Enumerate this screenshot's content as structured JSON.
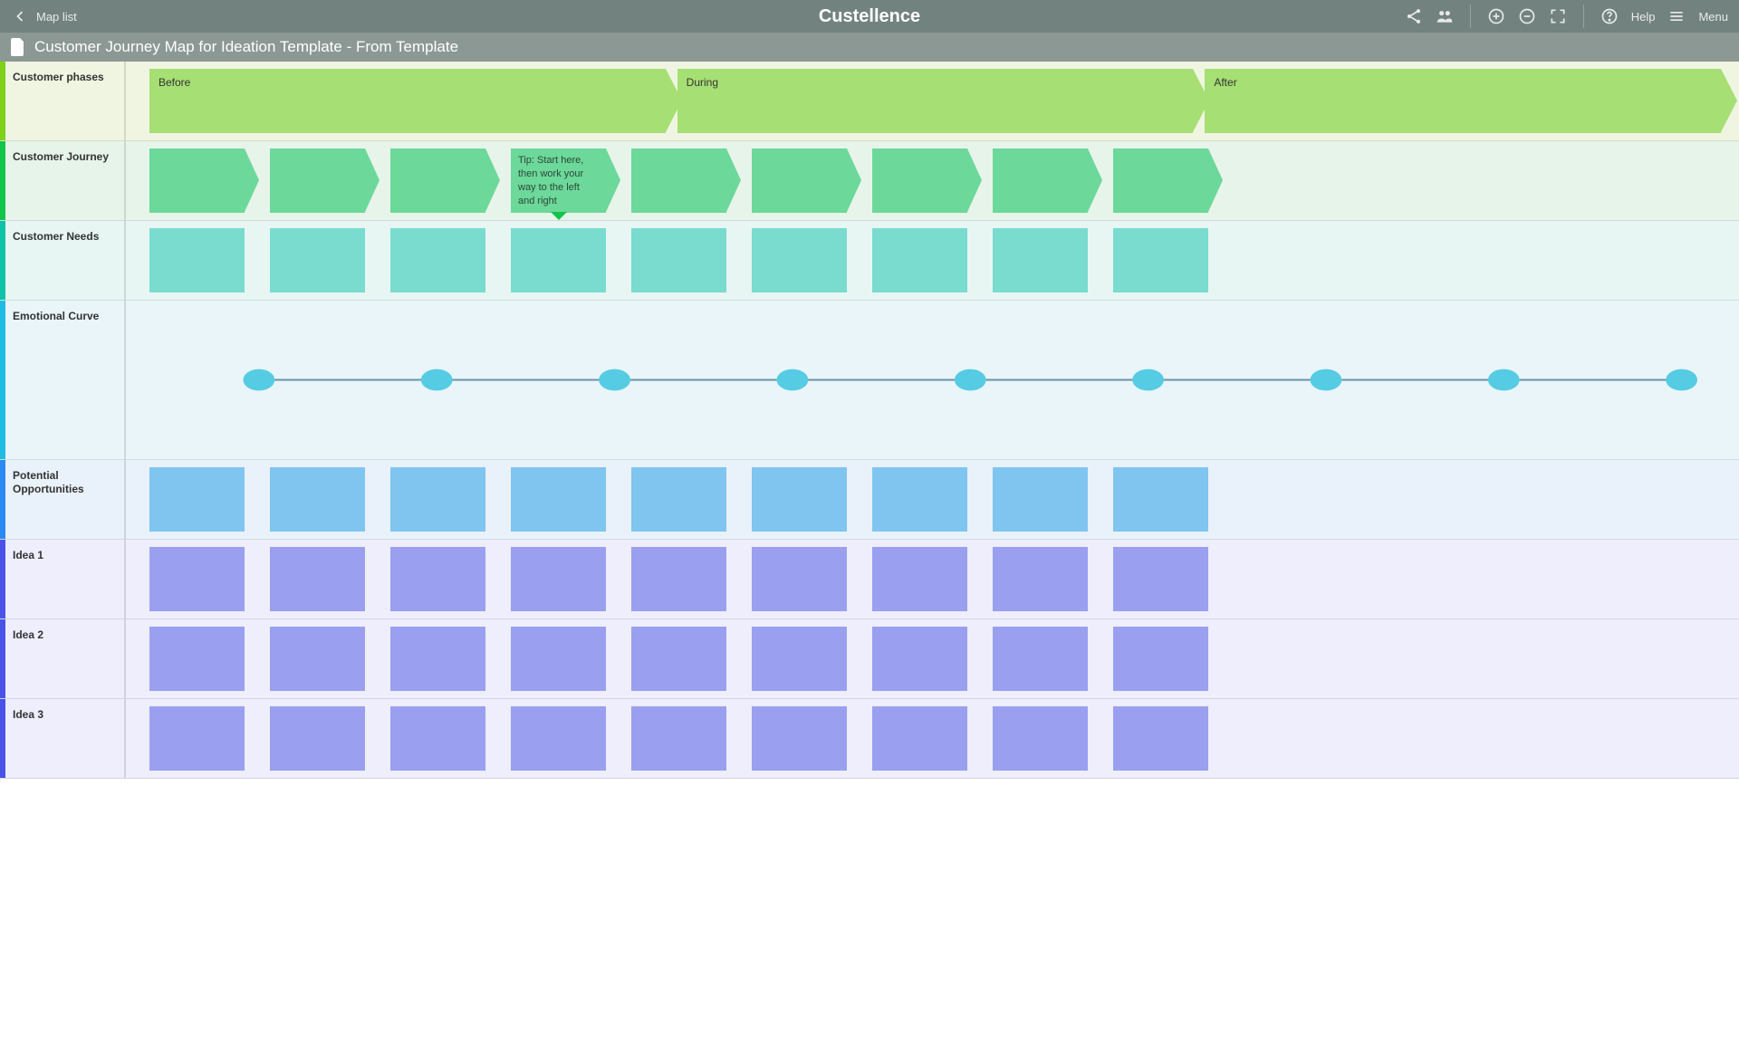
{
  "topbar": {
    "map_list_label": "Map list",
    "brand": "Custellence",
    "help_label": "Help",
    "menu_label": "Menu"
  },
  "subheader": {
    "title": "Customer Journey Map for Ideation Template - From Template"
  },
  "lanes": {
    "phases": {
      "label": "Customer phases",
      "items": [
        "Before",
        "During",
        "After"
      ]
    },
    "journey": {
      "label": "Customer Journey",
      "tip": "Tip: Start here, then work your way to the left and right",
      "count": 9,
      "tip_index": 3
    },
    "needs": {
      "label": "Customer Needs",
      "count": 9
    },
    "emotion": {
      "label": "Emotional Curve",
      "points": 9
    },
    "opportunities": {
      "label": "Potential Opportunities",
      "count": 9
    },
    "ideas": [
      {
        "label": "Idea 1",
        "count": 9
      },
      {
        "label": "Idea 2",
        "count": 9
      },
      {
        "label": "Idea 3",
        "count": 9
      }
    ]
  },
  "colors": {
    "phase_card": "#a6df74",
    "journey_card": "#6cd89a",
    "needs_card": "#79dccf",
    "emotion_dot": "#55cce3",
    "emotion_line": "#6b94a8",
    "opp_card": "#7fc5ef",
    "idea_card": "#9aa0ef"
  }
}
